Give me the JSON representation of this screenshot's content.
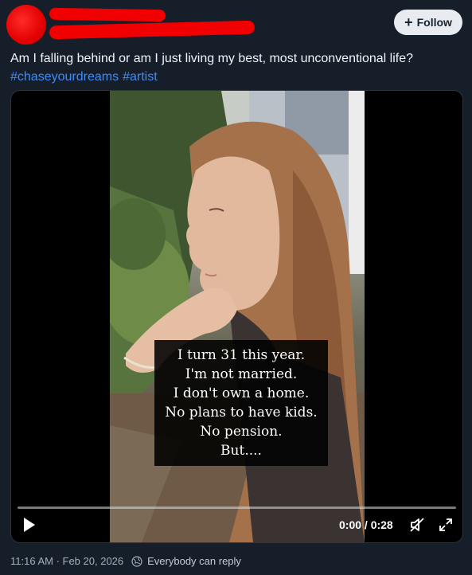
{
  "header": {
    "follow_label": "Follow"
  },
  "post": {
    "text": "Am I falling behind or am I just living my best, most unconventional life?",
    "hashtags": [
      "#chaseyourdreams",
      "#artist"
    ]
  },
  "video": {
    "overlay_lines": [
      "I turn 31 this year.",
      "I'm not married.",
      "I don't own a home.",
      "No plans to have kids.",
      "No pension.",
      "But...."
    ],
    "time_display": "0:00 / 0:28",
    "progress": 0
  },
  "footer": {
    "timestamp": "11:16 AM · Feb 20, 2026",
    "reply_setting": "Everybody can reply"
  },
  "colors": {
    "background": "#161e2a",
    "link": "#3d8bfd",
    "redaction": "#f00000"
  }
}
